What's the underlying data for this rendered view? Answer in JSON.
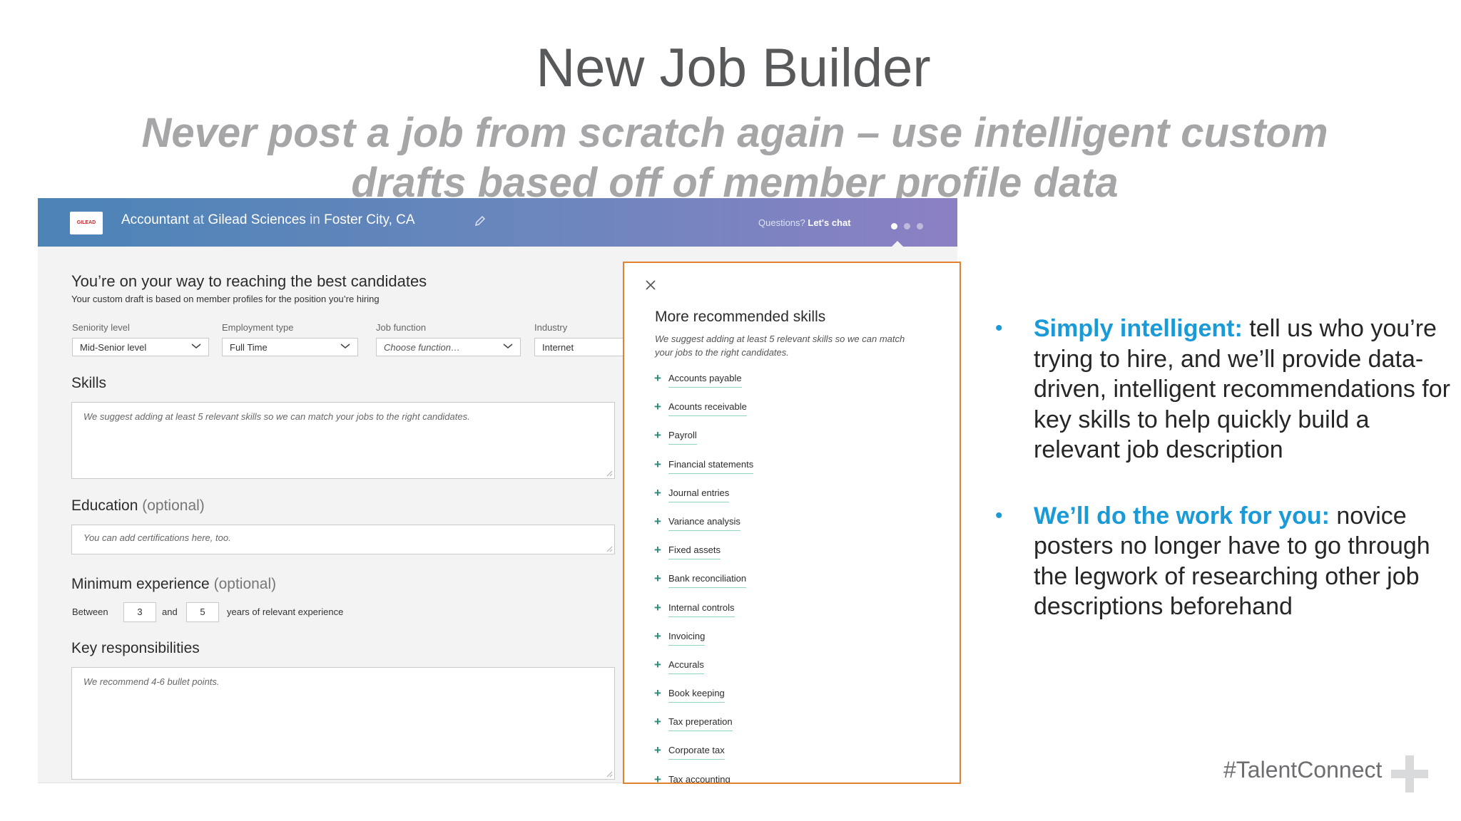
{
  "slide": {
    "title": "New Job Builder",
    "subtitle": "Never post a job from scratch again – use intelligent custom drafts based off of member profile data",
    "footer_tag": "#TalentConnect"
  },
  "app": {
    "header": {
      "logo_text": "GILEAD",
      "role": "Accountant",
      "at": "at",
      "company": "Gilead Sciences",
      "in": "in",
      "location": "Foster City, CA",
      "questions": "Questions?",
      "chat": "Let's chat"
    },
    "intro": {
      "title": "You’re on your way to reaching the best candidates",
      "subtitle": "Your custom draft is based on member profiles for the position you’re hiring"
    },
    "filters": [
      {
        "label": "Seniority level",
        "value": "Mid-Senior level"
      },
      {
        "label": "Employment type",
        "value": "Full Time"
      },
      {
        "label": "Job function",
        "value": "Choose function…"
      },
      {
        "label": "Industry",
        "value": "Internet"
      }
    ],
    "skills": {
      "label": "Skills",
      "placeholder": "We suggest adding at least 5 relevant skills so we can match your jobs to the right candidates."
    },
    "education": {
      "label": "Education",
      "optional": "(optional)",
      "placeholder": "You can add certifications here, too."
    },
    "experience": {
      "label": "Minimum experience",
      "optional": "(optional)",
      "between": "Between",
      "min": "3",
      "and": "and",
      "max": "5",
      "suffix": "years of relevant experience"
    },
    "responsibilities": {
      "label": "Key responsibilities",
      "placeholder": "We recommend 4-6 bullet points."
    }
  },
  "panel": {
    "title": "More recommended skills",
    "subtitle": "We suggest adding at least 5 relevant skills so we can match your jobs to the right candidates.",
    "skills": [
      "Accounts payable",
      "Acounts receivable",
      "Payroll",
      "Financial statements",
      "Journal entries",
      "Variance analysis",
      "Fixed assets",
      "Bank reconciliation",
      "Internal controls",
      "Invoicing",
      "Accurals",
      "Book keeping",
      "Tax preperation",
      "Corporate tax",
      "Tax accounting"
    ]
  },
  "bullets": [
    {
      "lead": "Simply intelligent:",
      "text": " tell us who you’re trying to hire, and we’ll provide data-driven, intelligent recommendations for key skills to help quickly build a relevant job description"
    },
    {
      "lead": "We’ll do the work for you:",
      "text": " novice posters no longer have to go through the legwork of researching other job descriptions beforehand"
    }
  ],
  "colors": {
    "accent_blue": "#1a9ad6",
    "panel_border": "#e0822f",
    "skill_plus": "#2b8a78"
  }
}
